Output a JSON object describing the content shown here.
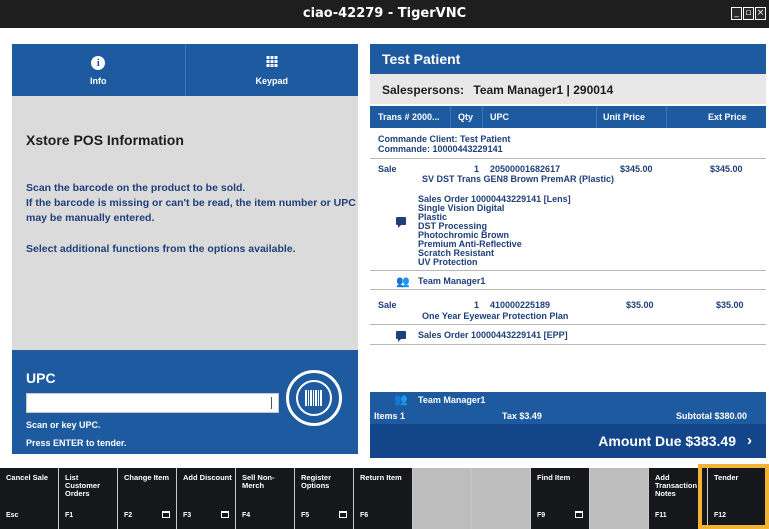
{
  "window": {
    "title": "ciao-42279 - TigerVNC",
    "controls": [
      "_",
      "▫",
      "×"
    ]
  },
  "left": {
    "nav": [
      {
        "label": "Info",
        "icon": "info-icon"
      },
      {
        "label": "Keypad",
        "icon": "keypad-icon"
      }
    ],
    "info_title": "Xstore POS Information",
    "info_lines": [
      "Scan the barcode on the product to be sold.",
      "If the barcode is missing or can't be read, the item number or UPC may be manually entered."
    ],
    "info_extra": "Select additional functions from the options available.",
    "upc": {
      "label": "UPC",
      "value": "",
      "placeholder": "",
      "hint": "Scan or key UPC.",
      "enter_hint": "Press ENTER to tender."
    }
  },
  "right": {
    "patient": "Test Patient",
    "salespersons_label": "Salespersons:",
    "salespersons_value": "Team Manager1 | 290014",
    "columns": [
      "Trans # 2000...",
      "Qty",
      "UPC",
      "Unit Price",
      "Ext Price"
    ],
    "commande_client": "Commande Client: Test Patient",
    "commande": "Commande: 10000443229141",
    "items": [
      {
        "type": "Sale",
        "qty": "1",
        "upc": "20500001682617",
        "unit_price": "$345.00",
        "ext_price": "$345.00",
        "description": "SV DST Trans GEN8 Brown PremAR (Plastic)",
        "details": [
          "Sales Order 10000443229141 [Lens]",
          "Single Vision Digital",
          "Plastic",
          "DST Processing",
          "Photochromic Brown",
          "Premium Anti-Reflective",
          "Scratch Resistant",
          "UV Protection"
        ],
        "salesperson": "Team Manager1"
      },
      {
        "type": "Sale",
        "qty": "1",
        "upc": "410000225189",
        "unit_price": "$35.00",
        "ext_price": "$35.00",
        "description": "One Year Eyewear Protection Plan",
        "details": [
          "Sales Order 10000443229141 [EPP]"
        ],
        "salesperson": "Team Manager1"
      }
    ],
    "totals": {
      "items": "Items 1",
      "tax": "Tax $3.49",
      "subtotal": "Subtotal $380.00"
    },
    "amount_due_label": "Amount Due",
    "amount_due_value": "$383.49",
    "amount_due_chevron": "›"
  },
  "fkeys": [
    {
      "label": "Cancel Sale",
      "key": "Esc",
      "style": "dark",
      "kb": false
    },
    {
      "label": "List Customer Orders",
      "key": "F1",
      "style": "dark",
      "kb": false
    },
    {
      "label": "Change Item",
      "key": "F2",
      "style": "dark",
      "kb": true
    },
    {
      "label": "Add Discount",
      "key": "F3",
      "style": "dark",
      "kb": true
    },
    {
      "label": "Sell Non-Merch",
      "key": "F4",
      "style": "dark",
      "kb": false
    },
    {
      "label": "Register Options",
      "key": "F5",
      "style": "dark",
      "kb": true
    },
    {
      "label": "Return Item",
      "key": "F6",
      "style": "dark",
      "kb": false
    },
    {
      "label": "",
      "key": "",
      "style": "light",
      "kb": false
    },
    {
      "label": "",
      "key": "",
      "style": "light",
      "kb": false
    },
    {
      "label": "Find Item",
      "key": "F9",
      "style": "dark",
      "kb": true
    },
    {
      "label": "",
      "key": "",
      "style": "light",
      "kb": false
    },
    {
      "label": "Add Transaction Notes",
      "key": "F11",
      "style": "dark",
      "kb": false
    },
    {
      "label": "Tender",
      "key": "F12",
      "style": "dark",
      "kb": false
    }
  ],
  "colors": {
    "brand_blue": "#1e5aa0",
    "dark_blue": "#12458a",
    "text_blue": "#1e3f7a",
    "highlight": "#f2b233"
  }
}
